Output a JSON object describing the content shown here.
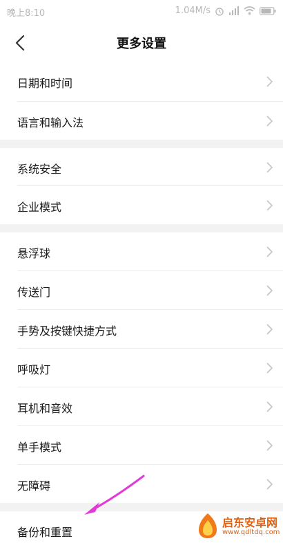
{
  "status_bar": {
    "time": "晚上8:10",
    "speed": "1.04M/s"
  },
  "header": {
    "title": "更多设置"
  },
  "groups": [
    {
      "items": [
        {
          "label": "日期和时间"
        },
        {
          "label": "语言和输入法"
        }
      ]
    },
    {
      "items": [
        {
          "label": "系统安全"
        },
        {
          "label": "企业模式"
        }
      ]
    },
    {
      "items": [
        {
          "label": "悬浮球"
        },
        {
          "label": "传送门"
        },
        {
          "label": "手势及按键快捷方式"
        },
        {
          "label": "呼吸灯"
        },
        {
          "label": "耳机和音效"
        },
        {
          "label": "单手模式"
        },
        {
          "label": "无障碍"
        }
      ]
    },
    {
      "items": [
        {
          "label": "备份和重置"
        }
      ]
    }
  ],
  "watermark": {
    "name": "启东安卓网",
    "url": "www.qdltdq.com"
  },
  "colors": {
    "annotation_arrow": "#e23ad6",
    "separator": "#f2f2f2",
    "chevron": "#c4c4c4"
  },
  "icons": [
    "back-arrow-icon",
    "chevron-right-icon",
    "alarm-icon",
    "signal-icon",
    "wifi-icon",
    "battery-icon"
  ]
}
